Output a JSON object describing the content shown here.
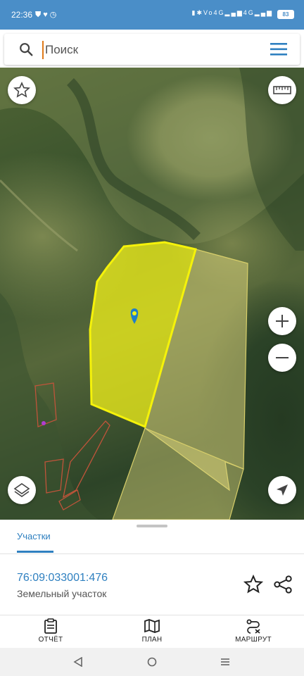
{
  "status_bar": {
    "time": "22:36",
    "left_icons": [
      "shield-icon",
      "heart-icon",
      "alarm-icon"
    ],
    "right_icons": [
      "vibrate-icon",
      "bluetooth-icon",
      "volte-icon",
      "4g-signal-icon",
      "4g-signal-icon"
    ],
    "battery": "83"
  },
  "search": {
    "placeholder": "Поиск"
  },
  "map": {
    "icons": [
      "favorite-star-icon",
      "ruler-icon",
      "zoom-in-icon",
      "zoom-out-icon",
      "layers-icon",
      "location-arrow-icon",
      "map-pin-icon"
    ],
    "colors": {
      "selected_parcel": "#f2f21a",
      "neighbor_parcel": "#d9d27a",
      "pin": "#1f7fc8"
    }
  },
  "panel": {
    "tab": "Участки",
    "parcel_id": "76:09:033001:476",
    "parcel_type": "Земельный участок"
  },
  "bottom_nav": {
    "report": "ОТЧЁТ",
    "plan": "ПЛАН",
    "route": "МАРШРУТ"
  },
  "accent_color": "#2f80c0"
}
